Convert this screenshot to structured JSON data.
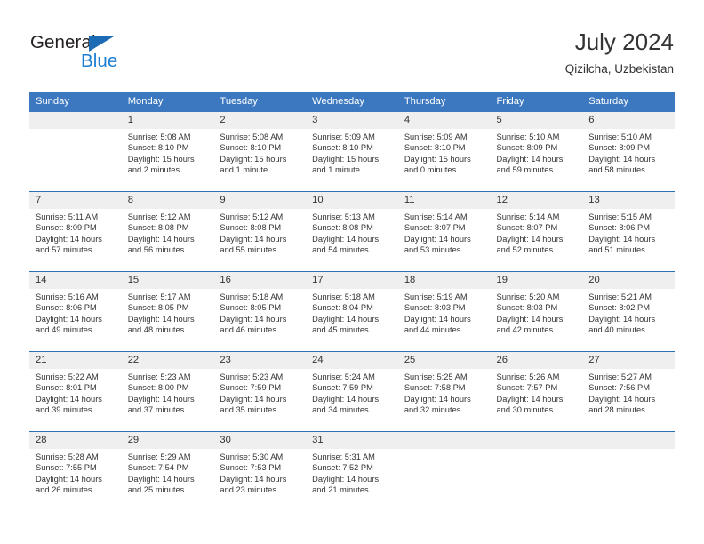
{
  "brand": {
    "word_general": "General",
    "word_blue": "Blue",
    "triangle_color": "#1b6cb5",
    "blue_text_color": "#1b7fd4"
  },
  "header": {
    "title": "July 2024",
    "subtitle": "Qizilcha, Uzbekistan"
  },
  "colors": {
    "header_band": "#3b78bf",
    "week_rule": "#2c6fb5",
    "daynum_band": "#efefef",
    "text": "#333333"
  },
  "weekday_headers": [
    "Sunday",
    "Monday",
    "Tuesday",
    "Wednesday",
    "Thursday",
    "Friday",
    "Saturday"
  ],
  "weeks": [
    {
      "days": [
        {
          "num": "",
          "sunrise": "",
          "sunset": "",
          "daylight1": "",
          "daylight2": ""
        },
        {
          "num": "1",
          "sunrise": "Sunrise: 5:08 AM",
          "sunset": "Sunset: 8:10 PM",
          "daylight1": "Daylight: 15 hours",
          "daylight2": "and 2 minutes."
        },
        {
          "num": "2",
          "sunrise": "Sunrise: 5:08 AM",
          "sunset": "Sunset: 8:10 PM",
          "daylight1": "Daylight: 15 hours",
          "daylight2": "and 1 minute."
        },
        {
          "num": "3",
          "sunrise": "Sunrise: 5:09 AM",
          "sunset": "Sunset: 8:10 PM",
          "daylight1": "Daylight: 15 hours",
          "daylight2": "and 1 minute."
        },
        {
          "num": "4",
          "sunrise": "Sunrise: 5:09 AM",
          "sunset": "Sunset: 8:10 PM",
          "daylight1": "Daylight: 15 hours",
          "daylight2": "and 0 minutes."
        },
        {
          "num": "5",
          "sunrise": "Sunrise: 5:10 AM",
          "sunset": "Sunset: 8:09 PM",
          "daylight1": "Daylight: 14 hours",
          "daylight2": "and 59 minutes."
        },
        {
          "num": "6",
          "sunrise": "Sunrise: 5:10 AM",
          "sunset": "Sunset: 8:09 PM",
          "daylight1": "Daylight: 14 hours",
          "daylight2": "and 58 minutes."
        }
      ]
    },
    {
      "days": [
        {
          "num": "7",
          "sunrise": "Sunrise: 5:11 AM",
          "sunset": "Sunset: 8:09 PM",
          "daylight1": "Daylight: 14 hours",
          "daylight2": "and 57 minutes."
        },
        {
          "num": "8",
          "sunrise": "Sunrise: 5:12 AM",
          "sunset": "Sunset: 8:08 PM",
          "daylight1": "Daylight: 14 hours",
          "daylight2": "and 56 minutes."
        },
        {
          "num": "9",
          "sunrise": "Sunrise: 5:12 AM",
          "sunset": "Sunset: 8:08 PM",
          "daylight1": "Daylight: 14 hours",
          "daylight2": "and 55 minutes."
        },
        {
          "num": "10",
          "sunrise": "Sunrise: 5:13 AM",
          "sunset": "Sunset: 8:08 PM",
          "daylight1": "Daylight: 14 hours",
          "daylight2": "and 54 minutes."
        },
        {
          "num": "11",
          "sunrise": "Sunrise: 5:14 AM",
          "sunset": "Sunset: 8:07 PM",
          "daylight1": "Daylight: 14 hours",
          "daylight2": "and 53 minutes."
        },
        {
          "num": "12",
          "sunrise": "Sunrise: 5:14 AM",
          "sunset": "Sunset: 8:07 PM",
          "daylight1": "Daylight: 14 hours",
          "daylight2": "and 52 minutes."
        },
        {
          "num": "13",
          "sunrise": "Sunrise: 5:15 AM",
          "sunset": "Sunset: 8:06 PM",
          "daylight1": "Daylight: 14 hours",
          "daylight2": "and 51 minutes."
        }
      ]
    },
    {
      "days": [
        {
          "num": "14",
          "sunrise": "Sunrise: 5:16 AM",
          "sunset": "Sunset: 8:06 PM",
          "daylight1": "Daylight: 14 hours",
          "daylight2": "and 49 minutes."
        },
        {
          "num": "15",
          "sunrise": "Sunrise: 5:17 AM",
          "sunset": "Sunset: 8:05 PM",
          "daylight1": "Daylight: 14 hours",
          "daylight2": "and 48 minutes."
        },
        {
          "num": "16",
          "sunrise": "Sunrise: 5:18 AM",
          "sunset": "Sunset: 8:05 PM",
          "daylight1": "Daylight: 14 hours",
          "daylight2": "and 46 minutes."
        },
        {
          "num": "17",
          "sunrise": "Sunrise: 5:18 AM",
          "sunset": "Sunset: 8:04 PM",
          "daylight1": "Daylight: 14 hours",
          "daylight2": "and 45 minutes."
        },
        {
          "num": "18",
          "sunrise": "Sunrise: 5:19 AM",
          "sunset": "Sunset: 8:03 PM",
          "daylight1": "Daylight: 14 hours",
          "daylight2": "and 44 minutes."
        },
        {
          "num": "19",
          "sunrise": "Sunrise: 5:20 AM",
          "sunset": "Sunset: 8:03 PM",
          "daylight1": "Daylight: 14 hours",
          "daylight2": "and 42 minutes."
        },
        {
          "num": "20",
          "sunrise": "Sunrise: 5:21 AM",
          "sunset": "Sunset: 8:02 PM",
          "daylight1": "Daylight: 14 hours",
          "daylight2": "and 40 minutes."
        }
      ]
    },
    {
      "days": [
        {
          "num": "21",
          "sunrise": "Sunrise: 5:22 AM",
          "sunset": "Sunset: 8:01 PM",
          "daylight1": "Daylight: 14 hours",
          "daylight2": "and 39 minutes."
        },
        {
          "num": "22",
          "sunrise": "Sunrise: 5:23 AM",
          "sunset": "Sunset: 8:00 PM",
          "daylight1": "Daylight: 14 hours",
          "daylight2": "and 37 minutes."
        },
        {
          "num": "23",
          "sunrise": "Sunrise: 5:23 AM",
          "sunset": "Sunset: 7:59 PM",
          "daylight1": "Daylight: 14 hours",
          "daylight2": "and 35 minutes."
        },
        {
          "num": "24",
          "sunrise": "Sunrise: 5:24 AM",
          "sunset": "Sunset: 7:59 PM",
          "daylight1": "Daylight: 14 hours",
          "daylight2": "and 34 minutes."
        },
        {
          "num": "25",
          "sunrise": "Sunrise: 5:25 AM",
          "sunset": "Sunset: 7:58 PM",
          "daylight1": "Daylight: 14 hours",
          "daylight2": "and 32 minutes."
        },
        {
          "num": "26",
          "sunrise": "Sunrise: 5:26 AM",
          "sunset": "Sunset: 7:57 PM",
          "daylight1": "Daylight: 14 hours",
          "daylight2": "and 30 minutes."
        },
        {
          "num": "27",
          "sunrise": "Sunrise: 5:27 AM",
          "sunset": "Sunset: 7:56 PM",
          "daylight1": "Daylight: 14 hours",
          "daylight2": "and 28 minutes."
        }
      ]
    },
    {
      "days": [
        {
          "num": "28",
          "sunrise": "Sunrise: 5:28 AM",
          "sunset": "Sunset: 7:55 PM",
          "daylight1": "Daylight: 14 hours",
          "daylight2": "and 26 minutes."
        },
        {
          "num": "29",
          "sunrise": "Sunrise: 5:29 AM",
          "sunset": "Sunset: 7:54 PM",
          "daylight1": "Daylight: 14 hours",
          "daylight2": "and 25 minutes."
        },
        {
          "num": "30",
          "sunrise": "Sunrise: 5:30 AM",
          "sunset": "Sunset: 7:53 PM",
          "daylight1": "Daylight: 14 hours",
          "daylight2": "and 23 minutes."
        },
        {
          "num": "31",
          "sunrise": "Sunrise: 5:31 AM",
          "sunset": "Sunset: 7:52 PM",
          "daylight1": "Daylight: 14 hours",
          "daylight2": "and 21 minutes."
        },
        {
          "num": "",
          "sunrise": "",
          "sunset": "",
          "daylight1": "",
          "daylight2": ""
        },
        {
          "num": "",
          "sunrise": "",
          "sunset": "",
          "daylight1": "",
          "daylight2": ""
        },
        {
          "num": "",
          "sunrise": "",
          "sunset": "",
          "daylight1": "",
          "daylight2": ""
        }
      ]
    }
  ]
}
